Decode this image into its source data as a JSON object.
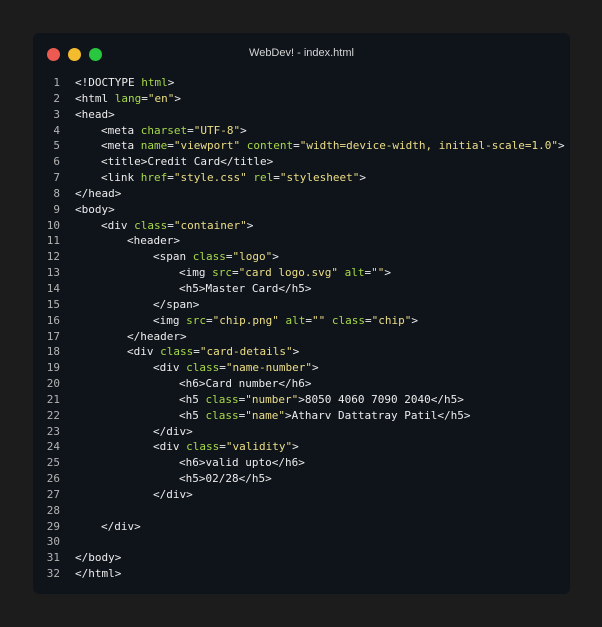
{
  "window": {
    "title": "WebDev! - index.html",
    "controls": [
      {
        "name": "close-button",
        "color": "#ec5a52"
      },
      {
        "name": "minimize-button",
        "color": "#f3bb2e"
      },
      {
        "name": "maximize-button",
        "color": "#28c73f"
      }
    ]
  },
  "editor": {
    "lines": [
      {
        "n": "1",
        "indent": 0,
        "tokens": [
          [
            "tag",
            "<!DOCTYPE "
          ],
          [
            "attr",
            "html"
          ],
          [
            "tag",
            ">"
          ]
        ]
      },
      {
        "n": "2",
        "indent": 0,
        "tokens": [
          [
            "tag",
            "<html "
          ],
          [
            "attr",
            "lang"
          ],
          [
            "tag",
            "="
          ],
          [
            "str",
            "\"en\""
          ],
          [
            "tag",
            ">"
          ]
        ]
      },
      {
        "n": "3",
        "indent": 0,
        "tokens": [
          [
            "tag",
            "<head>"
          ]
        ]
      },
      {
        "n": "4",
        "indent": 1,
        "tokens": [
          [
            "tag",
            "<meta "
          ],
          [
            "attr",
            "charset"
          ],
          [
            "tag",
            "="
          ],
          [
            "str",
            "\"UTF-8\""
          ],
          [
            "tag",
            ">"
          ]
        ]
      },
      {
        "n": "5",
        "indent": 1,
        "tokens": [
          [
            "tag",
            "<meta "
          ],
          [
            "attr",
            "name"
          ],
          [
            "tag",
            "="
          ],
          [
            "str",
            "\"viewport\""
          ],
          [
            "tag",
            " "
          ],
          [
            "attr",
            "content"
          ],
          [
            "tag",
            "="
          ],
          [
            "str",
            "\"width=device-width, initial-scale=1.0\""
          ],
          [
            "tag",
            ">"
          ]
        ]
      },
      {
        "n": "6",
        "indent": 1,
        "tokens": [
          [
            "tag",
            "<title>"
          ],
          [
            "text",
            "Credit Card"
          ],
          [
            "tag",
            "</title>"
          ]
        ]
      },
      {
        "n": "7",
        "indent": 1,
        "tokens": [
          [
            "tag",
            "<link "
          ],
          [
            "attr",
            "href"
          ],
          [
            "tag",
            "="
          ],
          [
            "str",
            "\"style.css\""
          ],
          [
            "tag",
            " "
          ],
          [
            "attr",
            "rel"
          ],
          [
            "tag",
            "="
          ],
          [
            "str",
            "\"stylesheet\""
          ],
          [
            "tag",
            ">"
          ]
        ]
      },
      {
        "n": "8",
        "indent": 0,
        "tokens": [
          [
            "tag",
            "</head>"
          ]
        ]
      },
      {
        "n": "9",
        "indent": 0,
        "tokens": [
          [
            "tag",
            "<body>"
          ]
        ]
      },
      {
        "n": "10",
        "indent": 1,
        "tokens": [
          [
            "tag",
            "<div "
          ],
          [
            "attr",
            "class"
          ],
          [
            "tag",
            "="
          ],
          [
            "str",
            "\"container\""
          ],
          [
            "tag",
            ">"
          ]
        ]
      },
      {
        "n": "11",
        "indent": 2,
        "tokens": [
          [
            "tag",
            "<header>"
          ]
        ]
      },
      {
        "n": "12",
        "indent": 3,
        "tokens": [
          [
            "tag",
            "<span "
          ],
          [
            "attr",
            "class"
          ],
          [
            "tag",
            "="
          ],
          [
            "str",
            "\"logo\""
          ],
          [
            "tag",
            ">"
          ]
        ]
      },
      {
        "n": "13",
        "indent": 4,
        "tokens": [
          [
            "tag",
            "<img "
          ],
          [
            "attr",
            "src"
          ],
          [
            "tag",
            "="
          ],
          [
            "str",
            "\"card logo.svg\""
          ],
          [
            "tag",
            " "
          ],
          [
            "attr",
            "alt"
          ],
          [
            "tag",
            "="
          ],
          [
            "str",
            "\"\""
          ],
          [
            "tag",
            ">"
          ]
        ]
      },
      {
        "n": "14",
        "indent": 4,
        "tokens": [
          [
            "tag",
            "<h5>"
          ],
          [
            "text",
            "Master Card"
          ],
          [
            "tag",
            "</h5>"
          ]
        ]
      },
      {
        "n": "15",
        "indent": 3,
        "tokens": [
          [
            "tag",
            "</span>"
          ]
        ]
      },
      {
        "n": "16",
        "indent": 3,
        "tokens": [
          [
            "tag",
            "<img "
          ],
          [
            "attr",
            "src"
          ],
          [
            "tag",
            "="
          ],
          [
            "str",
            "\"chip.png\""
          ],
          [
            "tag",
            " "
          ],
          [
            "attr",
            "alt"
          ],
          [
            "tag",
            "="
          ],
          [
            "str",
            "\"\""
          ],
          [
            "tag",
            " "
          ],
          [
            "attr",
            "class"
          ],
          [
            "tag",
            "="
          ],
          [
            "str",
            "\"chip\""
          ],
          [
            "tag",
            ">"
          ]
        ]
      },
      {
        "n": "17",
        "indent": 2,
        "tokens": [
          [
            "tag",
            "</header>"
          ]
        ]
      },
      {
        "n": "18",
        "indent": 2,
        "tokens": [
          [
            "tag",
            "<div "
          ],
          [
            "attr",
            "class"
          ],
          [
            "tag",
            "="
          ],
          [
            "str",
            "\"card-details\""
          ],
          [
            "tag",
            ">"
          ]
        ]
      },
      {
        "n": "19",
        "indent": 3,
        "tokens": [
          [
            "tag",
            "<div "
          ],
          [
            "attr",
            "class"
          ],
          [
            "tag",
            "="
          ],
          [
            "str",
            "\"name-number\""
          ],
          [
            "tag",
            ">"
          ]
        ]
      },
      {
        "n": "20",
        "indent": 4,
        "tokens": [
          [
            "tag",
            "<h6>"
          ],
          [
            "text",
            "Card number"
          ],
          [
            "tag",
            "</h6>"
          ]
        ]
      },
      {
        "n": "21",
        "indent": 4,
        "tokens": [
          [
            "tag",
            "<h5 "
          ],
          [
            "attr",
            "class"
          ],
          [
            "tag",
            "="
          ],
          [
            "str",
            "\"number\""
          ],
          [
            "tag",
            ">"
          ],
          [
            "text",
            "8050 4060 7090 2040"
          ],
          [
            "tag",
            "</h5>"
          ]
        ]
      },
      {
        "n": "22",
        "indent": 4,
        "tokens": [
          [
            "tag",
            "<h5 "
          ],
          [
            "attr",
            "class"
          ],
          [
            "tag",
            "="
          ],
          [
            "str",
            "\"name\""
          ],
          [
            "tag",
            ">"
          ],
          [
            "text",
            "Atharv Dattatray Patil"
          ],
          [
            "tag",
            "</h5>"
          ]
        ]
      },
      {
        "n": "23",
        "indent": 3,
        "tokens": [
          [
            "tag",
            "</div>"
          ]
        ]
      },
      {
        "n": "24",
        "indent": 3,
        "tokens": [
          [
            "tag",
            "<div "
          ],
          [
            "attr",
            "class"
          ],
          [
            "tag",
            "="
          ],
          [
            "str",
            "\"validity\""
          ],
          [
            "tag",
            ">"
          ]
        ]
      },
      {
        "n": "25",
        "indent": 4,
        "tokens": [
          [
            "tag",
            "<h6>"
          ],
          [
            "text",
            "valid upto"
          ],
          [
            "tag",
            "</h6>"
          ]
        ]
      },
      {
        "n": "26",
        "indent": 4,
        "tokens": [
          [
            "tag",
            "<h5>"
          ],
          [
            "text",
            "02/28"
          ],
          [
            "tag",
            "</h5>"
          ]
        ]
      },
      {
        "n": "27",
        "indent": 3,
        "tokens": [
          [
            "tag",
            "</div>"
          ]
        ]
      },
      {
        "n": "28",
        "indent": 0,
        "tokens": []
      },
      {
        "n": "29",
        "indent": 1,
        "tokens": [
          [
            "tag",
            "</div>"
          ]
        ]
      },
      {
        "n": "30",
        "indent": 0,
        "tokens": []
      },
      {
        "n": "31",
        "indent": 0,
        "tokens": [
          [
            "tag",
            "</body>"
          ]
        ]
      },
      {
        "n": "32",
        "indent": 0,
        "tokens": [
          [
            "tag",
            "</html>"
          ]
        ]
      }
    ]
  }
}
